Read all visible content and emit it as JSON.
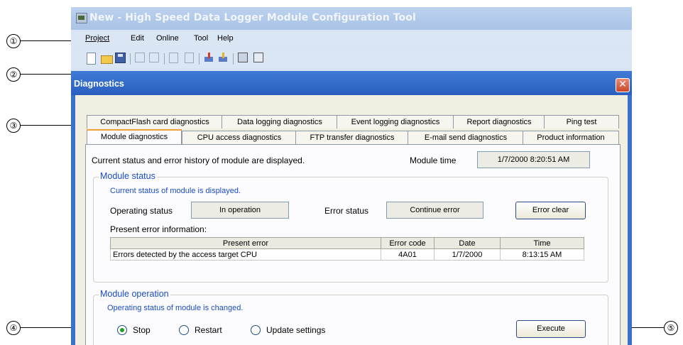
{
  "app": {
    "title": "New - High Speed Data Logger Module Configuration Tool",
    "menu": [
      "Project",
      "Edit",
      "Online",
      "Tool",
      "Help"
    ]
  },
  "toolbar": {
    "icons": [
      "new-icon",
      "open-icon",
      "save-icon",
      "import-icon",
      "export-icon",
      "copy-icon",
      "paste-icon",
      "write-icon",
      "read-icon",
      "diagnostics-icon",
      "connection-icon"
    ]
  },
  "dialog": {
    "title": "Diagnostics",
    "close_glyph": "✕",
    "tabs_back": [
      "CompactFlash card diagnostics",
      "Data logging diagnostics",
      "Event logging diagnostics",
      "Report diagnostics",
      "Ping test"
    ],
    "tabs_front": [
      "Module diagnostics",
      "CPU access diagnostics",
      "FTP transfer diagnostics",
      "E-mail send diagnostics",
      "Product information"
    ],
    "active_tab": "Module diagnostics"
  },
  "panel": {
    "description": "Current status and error history of module are displayed.",
    "module_time_label": "Module time",
    "module_time_value": "1/7/2000 8:20:51 AM",
    "module_status": {
      "title": "Module status",
      "subtitle": "Current status of module is displayed.",
      "operating_status_label": "Operating status",
      "operating_status_value": "In operation",
      "error_status_label": "Error status",
      "error_status_value": "Continue error",
      "error_clear_label": "Error clear",
      "present_error_info_label": "Present error information:",
      "table": {
        "headers": [
          "Present error",
          "Error code",
          "Date",
          "Time"
        ],
        "rows": [
          [
            "Errors detected by the access target CPU",
            "4A01",
            "1/7/2000",
            "8:13:15 AM"
          ]
        ]
      }
    },
    "module_operation": {
      "title": "Module operation",
      "subtitle": "Operating status of module is changed.",
      "options": [
        "Stop",
        "Restart",
        "Update settings"
      ],
      "selected": "Stop",
      "execute_label": "Execute"
    }
  },
  "callouts": [
    "①",
    "②",
    "③",
    "④",
    "⑤"
  ]
}
